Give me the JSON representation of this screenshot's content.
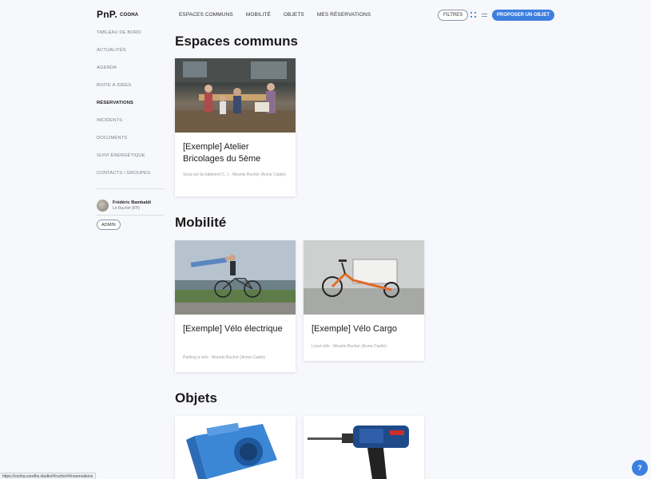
{
  "app": {
    "logo": "PnP.",
    "logo_sub": "COOHA"
  },
  "nav": {
    "items": [
      "Espaces communs",
      "Mobilité",
      "Objets",
      "Mes réservations"
    ]
  },
  "toolbar": {
    "filters_label": "Filtres",
    "propose_label": "Proposer un objet"
  },
  "sidebar": {
    "items": [
      {
        "label": "Tableau de bord",
        "active": false
      },
      {
        "label": "Actualités",
        "active": false
      },
      {
        "label": "Agenda",
        "active": false
      },
      {
        "label": "Boite à idées",
        "active": false
      },
      {
        "label": "Réservations",
        "active": true
      },
      {
        "label": "Incidents",
        "active": false
      },
      {
        "label": "Documents",
        "active": false
      },
      {
        "label": "Suivi énergétique",
        "active": false
      },
      {
        "label": "Contacts / Groupes",
        "active": false
      }
    ],
    "user_name": "Frédéric Bambaldi",
    "user_role": "Le Rucher [FP]",
    "admin_label": "Admin"
  },
  "sections": [
    {
      "title": "Espaces communs",
      "cards": [
        {
          "title": "[Exemple] Atelier Bricolages du 5ème",
          "meta": "Sous-sol du bâtiment C, 1 - Mounts Rucher (Acme Castle)",
          "image": "atelier-photo"
        }
      ]
    },
    {
      "title": "Mobilité",
      "cards": [
        {
          "title": "[Exemple] Vélo électrique",
          "meta": "Parking à vélo - Mounts Rucher (Acme Castle)",
          "image": "velo-photo"
        },
        {
          "title": "[Exemple] Vélo Cargo",
          "meta": "Local vélo - Mounts Rucher (Acme Castle)",
          "image": "cargo-photo"
        }
      ]
    },
    {
      "title": "Objets",
      "cards": [
        {
          "title": "",
          "meta": "",
          "image": "sharpener-photo"
        },
        {
          "title": "",
          "meta": "",
          "image": "drill-photo"
        }
      ]
    }
  ],
  "status_url": "https://cooha.coodhs.studio/#/rucher/#/reservations",
  "help_label": "?",
  "colors": {
    "accent": "#3d7fe0",
    "background": "#f7f8fb"
  }
}
